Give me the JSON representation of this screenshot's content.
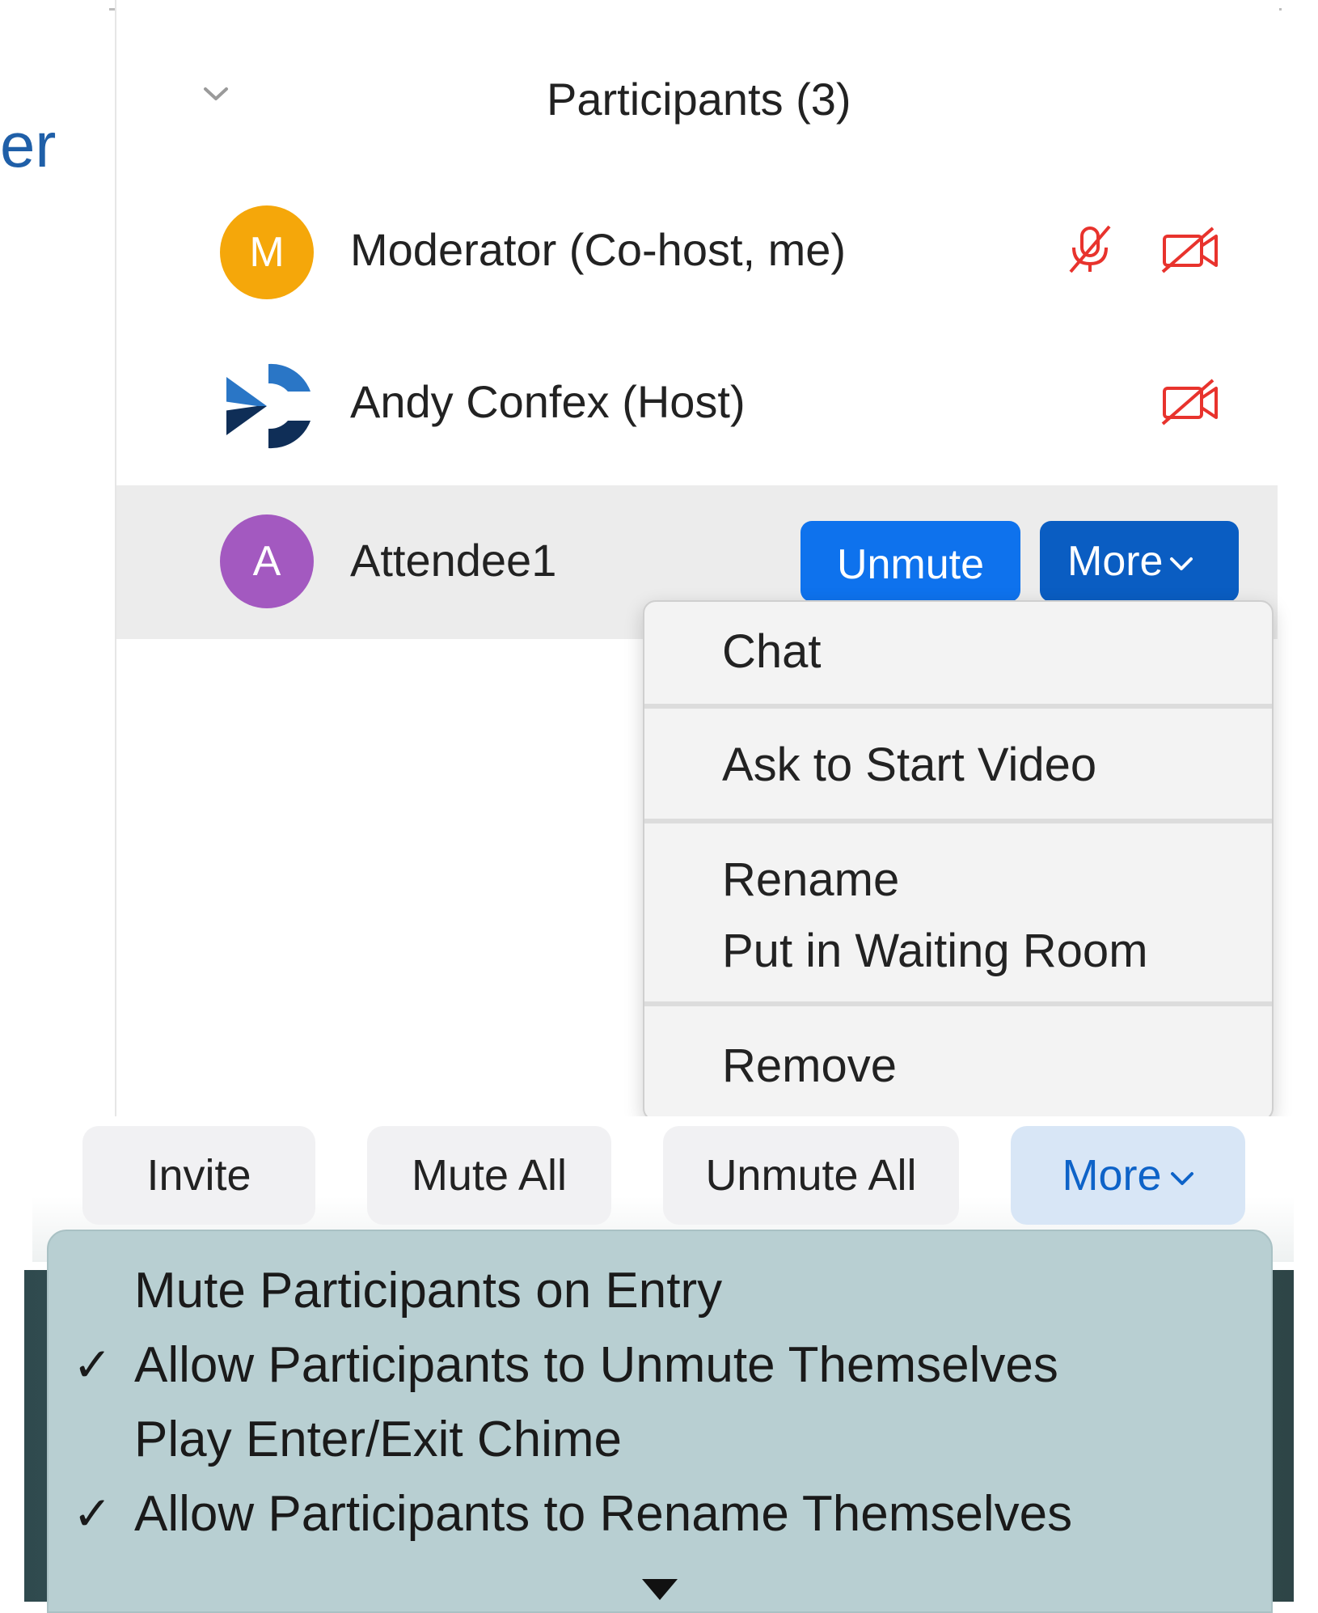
{
  "background": {
    "partial_text": "er"
  },
  "participants_panel": {
    "title": "Participants (3)",
    "participants": [
      {
        "name": "Moderator (Co-host, me)",
        "avatar_letter": "M",
        "avatar_color": "#f5a70a",
        "muted": true,
        "video_off": true
      },
      {
        "name": "Andy Confex (Host)",
        "avatar_logo": "confex-logo-icon",
        "video_off": true
      },
      {
        "name": "Attendee1",
        "avatar_letter": "A",
        "avatar_color": "#a359c0",
        "selected": true
      }
    ],
    "row_actions": {
      "unmute_label": "Unmute",
      "more_label": "More"
    }
  },
  "participant_context_menu": {
    "items": [
      "Chat",
      "Ask to Start Video",
      "Rename",
      "Put in Waiting Room",
      "Remove"
    ]
  },
  "footer": {
    "buttons": {
      "invite": "Invite",
      "mute_all": "Mute All",
      "unmute_all": "Unmute All",
      "more": "More"
    }
  },
  "more_options_menu": {
    "items": [
      {
        "label": "Mute Participants on Entry",
        "checked": false
      },
      {
        "label": "Allow Participants to Unmute Themselves",
        "checked": true
      },
      {
        "label": "Play Enter/Exit Chime",
        "checked": false
      },
      {
        "label": "Allow Participants to Rename Themselves",
        "checked": true
      }
    ],
    "check_glyph": "✓"
  },
  "colors": {
    "accent_blue": "#0e72ed",
    "accent_blue_dark": "#0a5dc2",
    "muted_red": "#e8332d"
  }
}
